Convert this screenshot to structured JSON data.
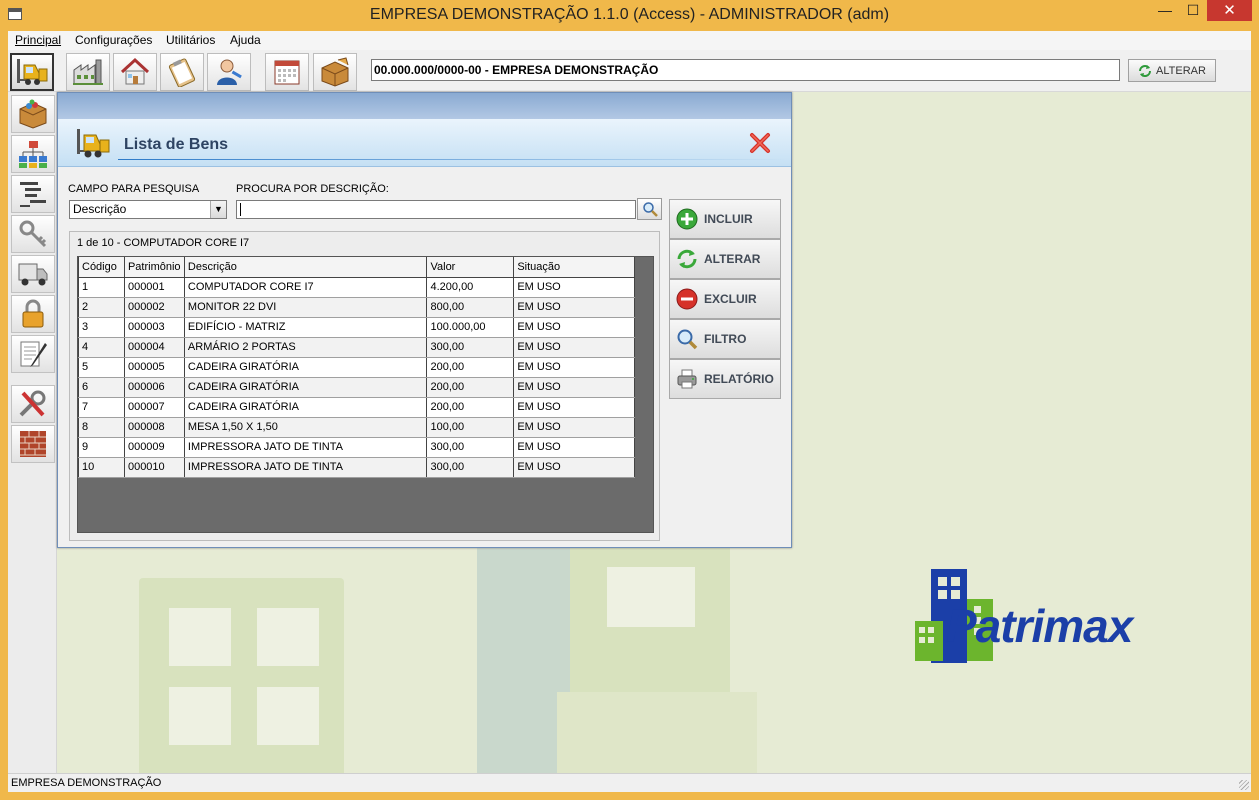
{
  "window": {
    "title": "EMPRESA DEMONSTRAÇÃO 1.1.0 (Access) - ADMINISTRADOR (adm)",
    "minimize": "—",
    "maximize": "☐",
    "close": "✕"
  },
  "menu": [
    "Principal",
    "Configurações",
    "Utilitários",
    "Ajuda"
  ],
  "toolbar": {
    "icons": [
      "forklift-icon",
      "factory-icon",
      "house-icon",
      "clipboard-icon",
      "user-icon",
      "calendar-icon",
      "box-icon"
    ],
    "company": "00.000.000/0000-00 - EMPRESA DEMONSTRAÇÃO",
    "alterar_label": "ALTERAR"
  },
  "sidebar": {
    "icons": [
      "box-icon",
      "org-chart-icon",
      "tree-list-icon",
      "keys-icon",
      "truck-icon",
      "padlock-icon",
      "document-pen-icon",
      "tools-icon",
      "brick-wall-icon"
    ]
  },
  "dialog": {
    "title": "Lista de Bens",
    "campo_label": "CAMPO PARA PESQUISA",
    "campo_value": "Descrição",
    "procura_label": "PROCURA POR DESCRIÇÃO:",
    "search_value": "",
    "record_info": "1 de 10 - COMPUTADOR CORE I7",
    "columns": [
      "Código",
      "Patrimônio",
      "Descrição",
      "Valor",
      "Situação"
    ],
    "rows": [
      [
        "1",
        "000001",
        "COMPUTADOR CORE I7",
        "4.200,00",
        "EM USO"
      ],
      [
        "2",
        "000002",
        "MONITOR 22 DVI",
        "800,00",
        "EM USO"
      ],
      [
        "3",
        "000003",
        "EDIFÍCIO - MATRIZ",
        "100.000,00",
        "EM USO"
      ],
      [
        "4",
        "000004",
        "ARMÁRIO 2 PORTAS",
        "300,00",
        "EM USO"
      ],
      [
        "5",
        "000005",
        "CADEIRA GIRATÓRIA",
        "200,00",
        "EM USO"
      ],
      [
        "6",
        "000006",
        "CADEIRA GIRATÓRIA",
        "200,00",
        "EM USO"
      ],
      [
        "7",
        "000007",
        "CADEIRA GIRATÓRIA",
        "200,00",
        "EM USO"
      ],
      [
        "8",
        "000008",
        "MESA 1,50 X 1,50",
        "100,00",
        "EM USO"
      ],
      [
        "9",
        "000009",
        "IMPRESSORA JATO DE TINTA",
        "300,00",
        "EM USO"
      ],
      [
        "10",
        "000010",
        "IMPRESSORA JATO DE TINTA",
        "300,00",
        "EM USO"
      ]
    ],
    "buttons": {
      "incluir": "INCLUIR",
      "alterar": "ALTERAR",
      "excluir": "EXCLUIR",
      "filtro": "FILTRO",
      "relatorio": "RELATÓRIO"
    }
  },
  "logo": {
    "text": "Patrimax"
  },
  "status": {
    "text": "EMPRESA DEMONSTRAÇÃO"
  },
  "colors": {
    "title_bar": "#f0b84a",
    "close_button": "#c7372f",
    "dialog_header": "#c5e0f4",
    "logo_blue": "#1b3fa8",
    "logo_green": "#6cb52d"
  }
}
